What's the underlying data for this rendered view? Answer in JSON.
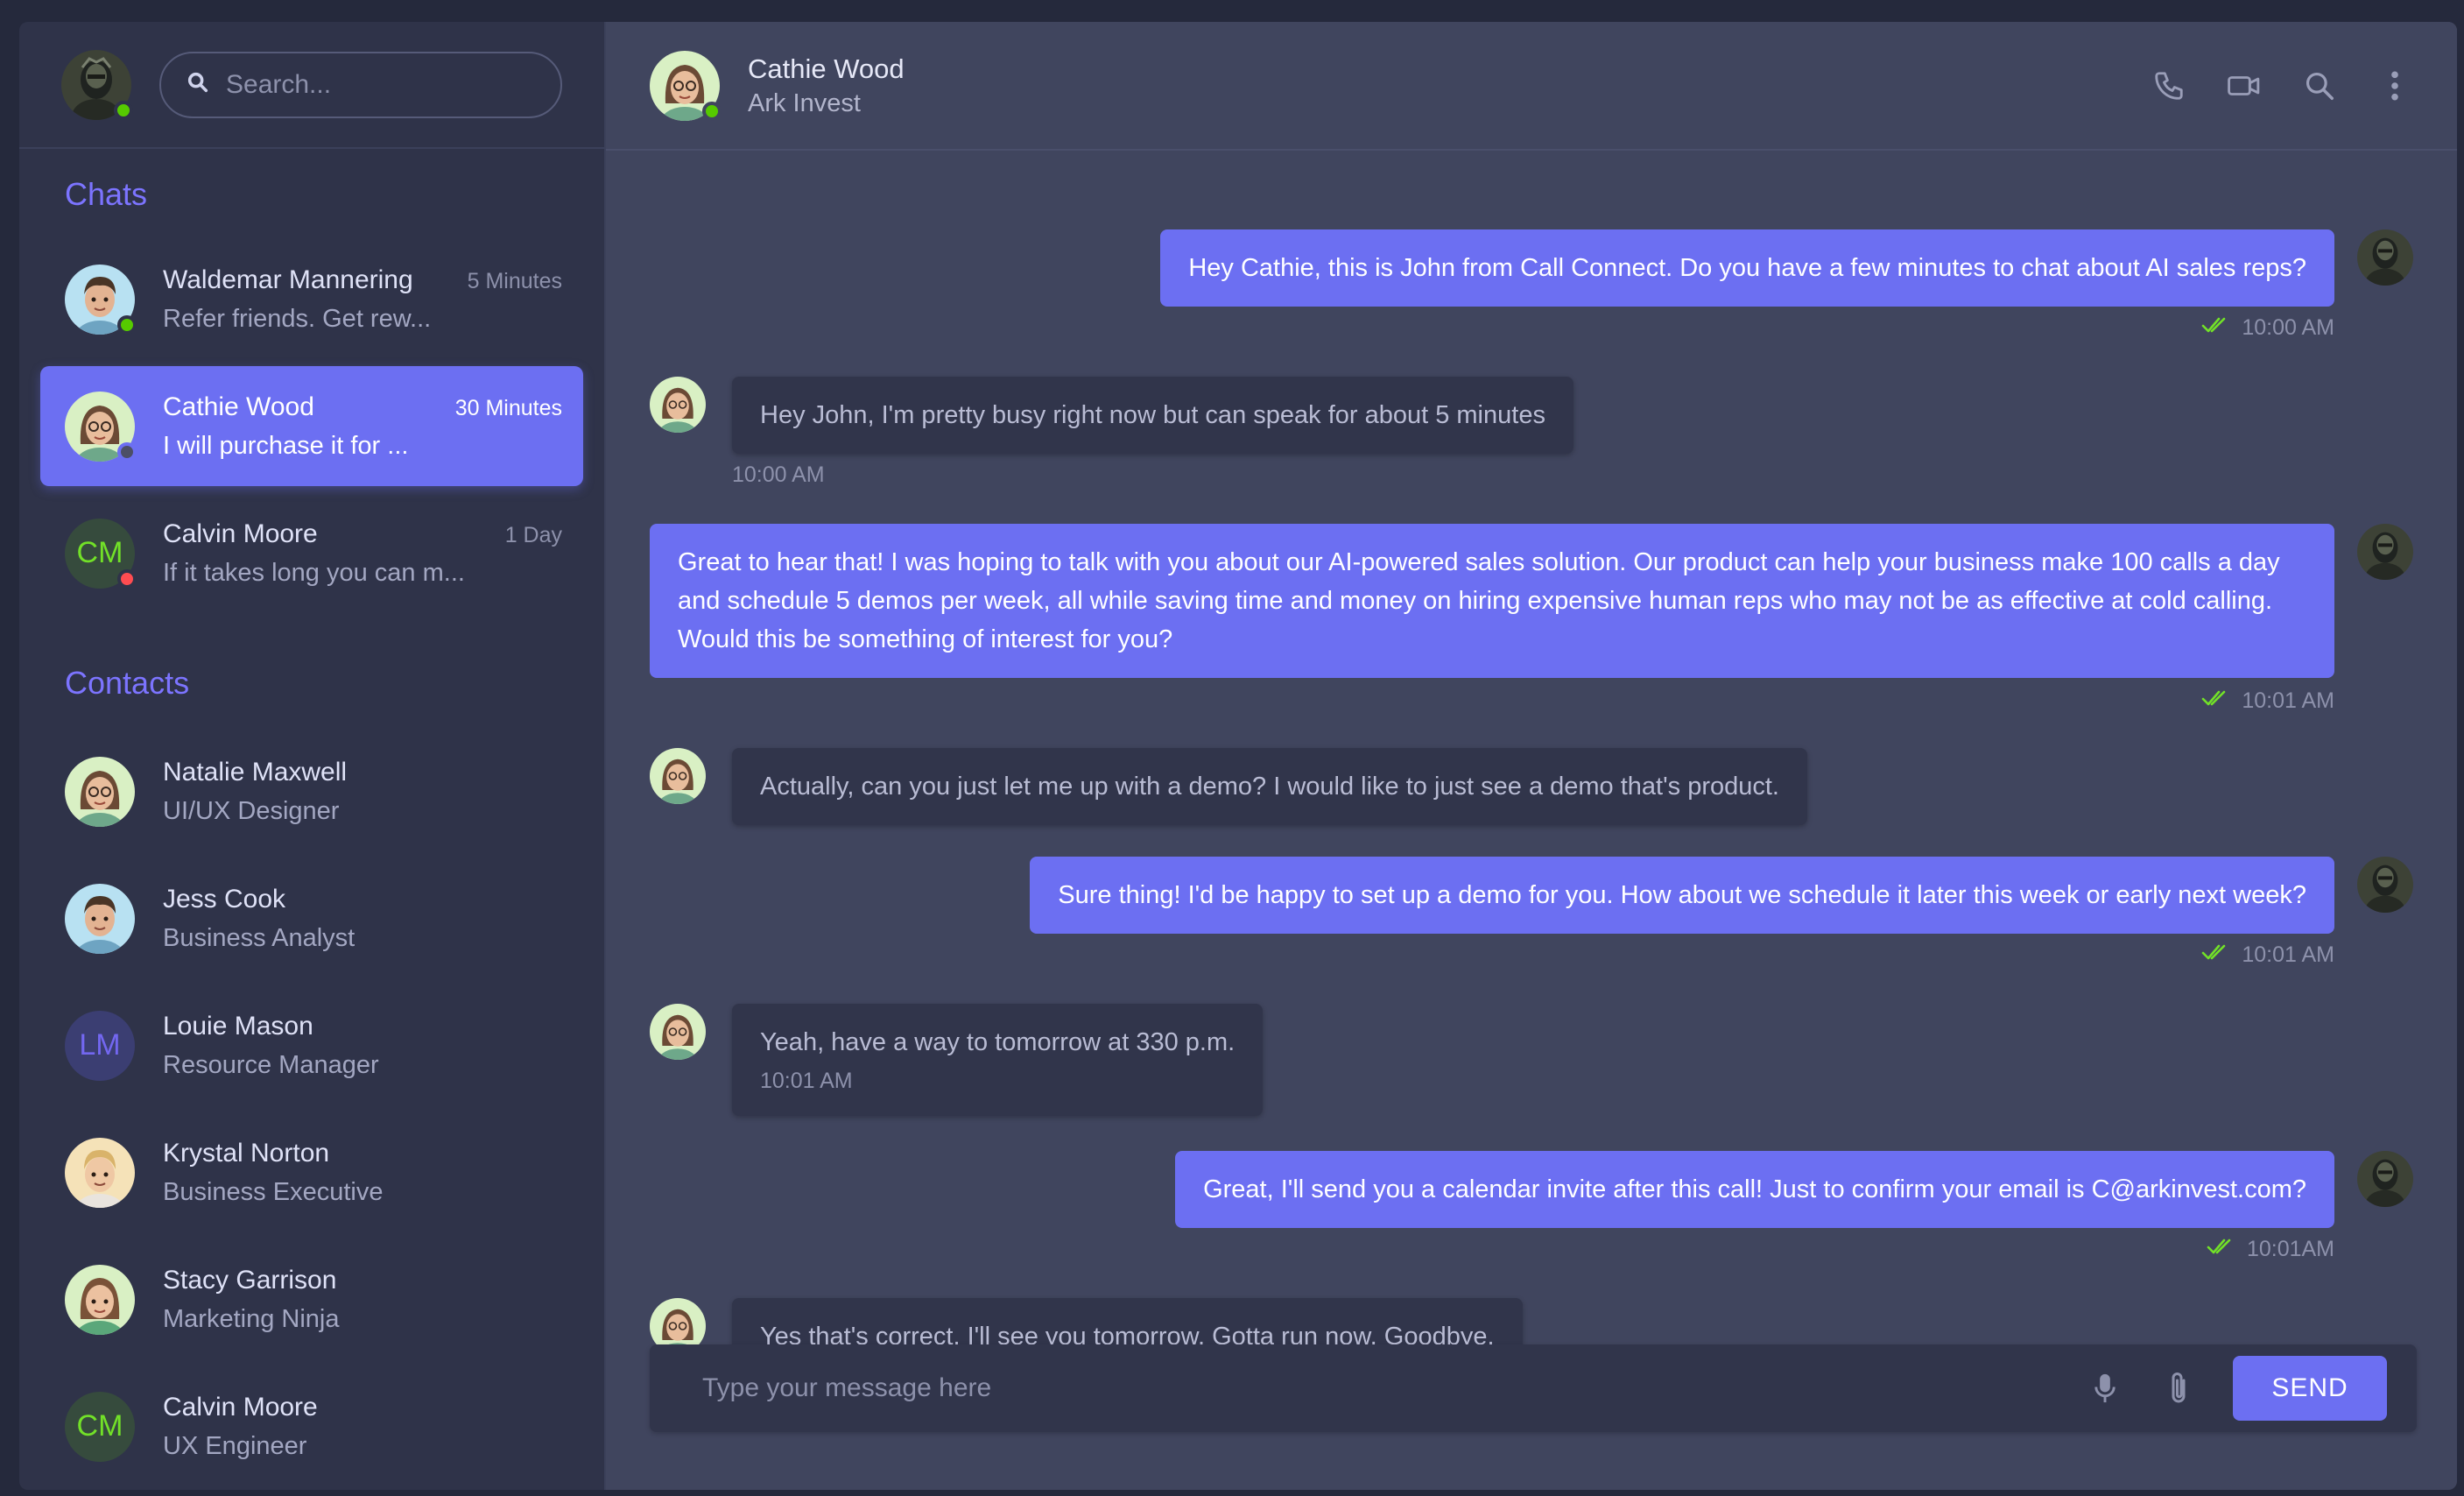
{
  "sidebar": {
    "search_placeholder": "Search...",
    "chats_title": "Chats",
    "contacts_title": "Contacts",
    "chats": [
      {
        "name": "Waldemar Mannering",
        "time": "5 Minutes",
        "preview": "Refer friends. Get rew...",
        "status": "online"
      },
      {
        "name": "Cathie Wood",
        "time": "30 Minutes",
        "preview": "I will purchase it for ...",
        "status": "away"
      },
      {
        "name": "Calvin Moore",
        "time": "1 Day",
        "preview": "If it takes long you can m...",
        "status": "busy",
        "initials": "CM"
      }
    ],
    "contacts": [
      {
        "name": "Natalie Maxwell",
        "role": "UI/UX Designer"
      },
      {
        "name": "Jess Cook",
        "role": "Business Analyst"
      },
      {
        "name": "Louie Mason",
        "role": "Resource Manager",
        "initials": "LM"
      },
      {
        "name": "Krystal Norton",
        "role": "Business Executive"
      },
      {
        "name": "Stacy Garrison",
        "role": "Marketing Ninja"
      },
      {
        "name": "Calvin Moore",
        "role": "UX Engineer",
        "initials": "CM"
      }
    ]
  },
  "chat": {
    "contact_name": "Cathie Wood",
    "contact_company": "Ark Invest",
    "messages": [
      {
        "from": "me",
        "text": "Hey Cathie, this is John from Call Connect. Do you have a few minutes to chat about AI sales reps?",
        "time": "10:00 AM"
      },
      {
        "from": "them",
        "text": "Hey John, I'm pretty busy right now but can speak for about 5 minutes",
        "time": "10:00 AM"
      },
      {
        "from": "me",
        "text": "Great to hear that! I was hoping to talk with you about our AI-powered sales solution. Our product can help your business make 100 calls a day and schedule 5 demos per week, all while saving time and money on hiring expensive human reps who may not be as effective at cold calling. Would this be something of interest for you?",
        "time": "10:01 AM"
      },
      {
        "from": "them",
        "text": "Actually, can you just let me up with a demo? I would like to just see a demo that's product.",
        "time": ""
      },
      {
        "from": "me",
        "text": "Sure thing! I'd be happy to set up a demo for you. How about we schedule it later this week or early next week?",
        "time": "10:01 AM"
      },
      {
        "from": "them",
        "text": "Yeah, have a way to tomorrow at 330 p.m.",
        "time": "10:01 AM"
      },
      {
        "from": "me",
        "text": "Great, I'll send you a calendar invite after this call! Just to confirm your email is C@arkinvest.com?",
        "time": "10:01AM"
      },
      {
        "from": "them",
        "text": "Yes that's correct. I'll see you tomorrow. Gotta run now, Goodbye.",
        "time": ""
      }
    ]
  },
  "composer": {
    "placeholder": "Type your message here",
    "send_label": "SEND"
  },
  "colors": {
    "accent": "#6c6ff2",
    "online": "#56ca00",
    "busy": "#ff4c51",
    "read_check": "#72e128"
  }
}
